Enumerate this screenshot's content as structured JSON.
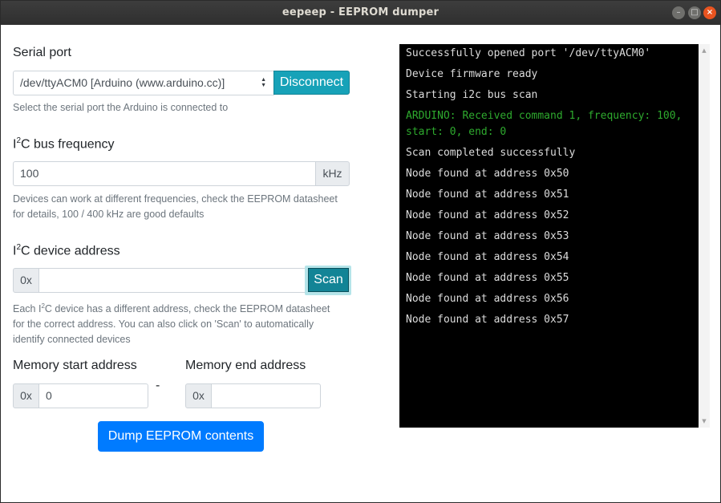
{
  "window": {
    "title": "eepeep - EEPROM dumper",
    "controls": {
      "minimize": "–",
      "maximize": "□",
      "close": "×"
    }
  },
  "serial_port": {
    "label": "Serial port",
    "selected": "/dev/ttyACM0 [Arduino (www.arduino.cc)]",
    "disconnect_label": "Disconnect",
    "help": "Select the serial port the Arduino is connected to"
  },
  "bus_frequency": {
    "label_prefix": "I",
    "label_sup": "2",
    "label_suffix": "C bus frequency",
    "value": "100",
    "unit": "kHz",
    "help_line1": "Devices can work at different frequencies, check the EEPROM datasheet",
    "help_line2": "for details, 100 / 400 kHz are good defaults"
  },
  "device_address": {
    "label_prefix": "I",
    "label_sup": "2",
    "label_suffix": "C device address",
    "prefix": "0x",
    "value": "",
    "scan_label": "Scan",
    "help_line1_a": "Each I",
    "help_line1_sup": "2",
    "help_line1_b": "C device has a different address, check the EEPROM datasheet",
    "help_line2": "for the correct address. You can also click on 'Scan' to automatically",
    "help_line3": "identify connected devices"
  },
  "memory": {
    "start_label": "Memory start address",
    "start_prefix": "0x",
    "start_value": "0",
    "separator": "-",
    "end_label": "Memory end address",
    "end_prefix": "0x",
    "end_value": ""
  },
  "dump_button_label": "Dump EEPROM contents",
  "console": {
    "lines": [
      {
        "text": "Successfully opened port '/dev/ttyACM0'",
        "color": "#dcdcdc"
      },
      {
        "text": "Device firmware ready",
        "color": "#dcdcdc"
      },
      {
        "text": "Starting i2c bus scan",
        "color": "#dcdcdc"
      },
      {
        "text": "ARDUINO: Received command 1, frequency: 100, start: 0, end: 0",
        "color": "#2eaa2e"
      },
      {
        "text": "Scan completed successfully",
        "color": "#dcdcdc"
      },
      {
        "text": "Node found at address 0x50",
        "color": "#dcdcdc"
      },
      {
        "text": "Node found at address 0x51",
        "color": "#dcdcdc"
      },
      {
        "text": "Node found at address 0x52",
        "color": "#dcdcdc"
      },
      {
        "text": "Node found at address 0x53",
        "color": "#dcdcdc"
      },
      {
        "text": "Node found at address 0x54",
        "color": "#dcdcdc"
      },
      {
        "text": "Node found at address 0x55",
        "color": "#dcdcdc"
      },
      {
        "text": "Node found at address 0x56",
        "color": "#dcdcdc"
      },
      {
        "text": "Node found at address 0x57",
        "color": "#dcdcdc"
      }
    ]
  },
  "colors": {
    "primary": "#007bff",
    "info": "#17a2b8",
    "console_bg": "#000000",
    "console_text": "#dcdcdc",
    "console_arduino": "#2eaa2e",
    "titlebar": "#353535",
    "close_button": "#e95420"
  }
}
